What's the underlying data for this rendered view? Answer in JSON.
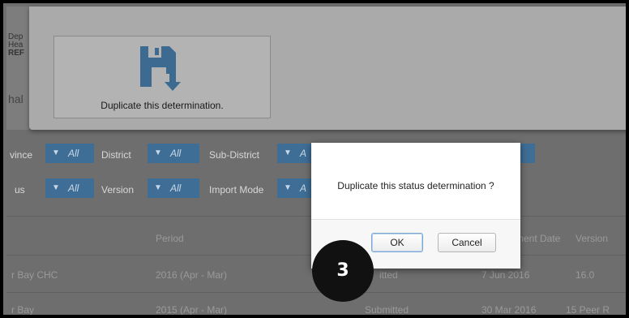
{
  "background": {
    "left_fragments": [
      "Dep",
      "Hea",
      "REF",
      "hal"
    ],
    "filters_row1": [
      {
        "label": "vince",
        "chip": "All"
      },
      {
        "label": "District",
        "chip": "All"
      },
      {
        "label": "Sub-District",
        "chip": "A"
      }
    ],
    "filters_row2": [
      {
        "label": "us",
        "chip": "All"
      },
      {
        "label": "Version",
        "chip": "All"
      },
      {
        "label": "Import Mode",
        "chip": "A"
      }
    ],
    "table": {
      "headers": [
        "Period",
        "ment Date",
        "Version"
      ],
      "rows": [
        {
          "name": "r Bay CHC",
          "period": "2016 (Apr - Mar)",
          "status": "itted",
          "date": "7 Jun 2016",
          "version": "16.0"
        },
        {
          "name": "r Bay",
          "period": "2015 (Apr - Mar)",
          "status": "Submitted",
          "date": "30 Mar 2016",
          "version": "15 Peer R"
        }
      ]
    }
  },
  "toolbar": {
    "duplicate_label": "Duplicate this determination.",
    "duplicate_icon": "save-duplicate-icon"
  },
  "dialog": {
    "message": "Duplicate this status determination ?",
    "ok_label": "OK",
    "cancel_label": "Cancel"
  },
  "step_marker": "3",
  "colors": {
    "chip": "#3e6d96",
    "icon": "#3d6a90",
    "overlay": "#6e6e6e"
  }
}
